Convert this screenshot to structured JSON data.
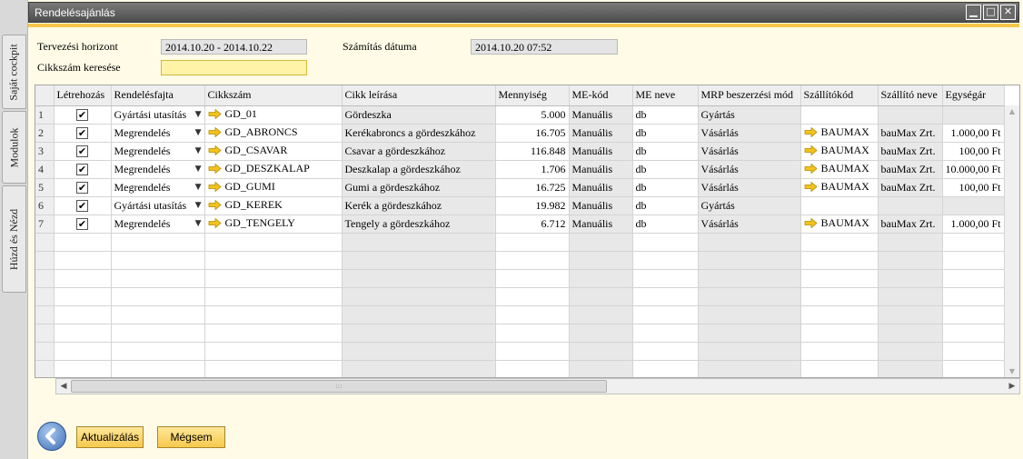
{
  "side_tabs": [
    "Saját cockpit",
    "Modulok",
    "Húzd és Nézd"
  ],
  "window": {
    "title": "Rendelésajánlás",
    "controls": [
      "minimize",
      "maximize",
      "close"
    ]
  },
  "form": {
    "horizon_label": "Tervezési horizont",
    "horizon_value": "2014.10.20 - 2014.10.22",
    "calc_date_label": "Számítás dátuma",
    "calc_date_value": "2014.10.20  07:52",
    "search_label": "Cikkszám keresése",
    "search_value": ""
  },
  "grid": {
    "columns": [
      "",
      "Létrehozás",
      "Rendelésfajta",
      "Cikkszám",
      "Cikk leírása",
      "Mennyiség",
      "ME-kód",
      "ME neve",
      "MRP beszerzési mód",
      "Szállítókód",
      "Szállító neve",
      "Egységár"
    ],
    "rows": [
      {
        "num": "1",
        "checked": true,
        "type": "Gyártási utasítás",
        "item": "GD_01",
        "desc": "Gördeszka",
        "qty": "5.000",
        "me_code": "Manuális",
        "me_name": "db",
        "mrp": "Gyártás",
        "supplier_code": "",
        "supplier_name": "",
        "price": ""
      },
      {
        "num": "2",
        "checked": true,
        "type": "Megrendelés",
        "item": "GD_ABRONCS",
        "desc": "Kerékabroncs a gördeszkához",
        "qty": "16.705",
        "me_code": "Manuális",
        "me_name": "db",
        "mrp": "Vásárlás",
        "supplier_code": "BAUMAX",
        "supplier_name": "bauMax Zrt.",
        "price": "1.000,00 Ft"
      },
      {
        "num": "3",
        "checked": true,
        "type": "Megrendelés",
        "item": "GD_CSAVAR",
        "desc": "Csavar a gördeszkához",
        "qty": "116.848",
        "me_code": "Manuális",
        "me_name": "db",
        "mrp": "Vásárlás",
        "supplier_code": "BAUMAX",
        "supplier_name": "bauMax Zrt.",
        "price": "100,00 Ft"
      },
      {
        "num": "4",
        "checked": true,
        "type": "Megrendelés",
        "item": "GD_DESZKALAP",
        "desc": "Deszkalap a gördeszkához",
        "qty": "1.706",
        "me_code": "Manuális",
        "me_name": "db",
        "mrp": "Vásárlás",
        "supplier_code": "BAUMAX",
        "supplier_name": "bauMax Zrt.",
        "price": "10.000,00 Ft"
      },
      {
        "num": "5",
        "checked": true,
        "type": "Megrendelés",
        "item": "GD_GUMI",
        "desc": "Gumi a gördeszkához",
        "qty": "16.725",
        "me_code": "Manuális",
        "me_name": "db",
        "mrp": "Vásárlás",
        "supplier_code": "BAUMAX",
        "supplier_name": "bauMax Zrt.",
        "price": "100,00 Ft"
      },
      {
        "num": "6",
        "checked": true,
        "type": "Gyártási utasítás",
        "item": "GD_KEREK",
        "desc": "Kerék a gördeszkához",
        "qty": "19.982",
        "me_code": "Manuális",
        "me_name": "db",
        "mrp": "Gyártás",
        "supplier_code": "",
        "supplier_name": "",
        "price": ""
      },
      {
        "num": "7",
        "checked": true,
        "type": "Megrendelés",
        "item": "GD_TENGELY",
        "desc": "Tengely a gördeszkához",
        "qty": "6.712",
        "me_code": "Manuális",
        "me_name": "db",
        "mrp": "Vásárlás",
        "supplier_code": "BAUMAX",
        "supplier_name": "bauMax Zrt.",
        "price": "1.000,00 Ft"
      }
    ]
  },
  "buttons": {
    "update": "Aktualizálás",
    "cancel": "Mégsem"
  },
  "colors": {
    "accent": "#f5c84a",
    "button": "#f7c94d",
    "link_arrow": "#f2c31d"
  }
}
